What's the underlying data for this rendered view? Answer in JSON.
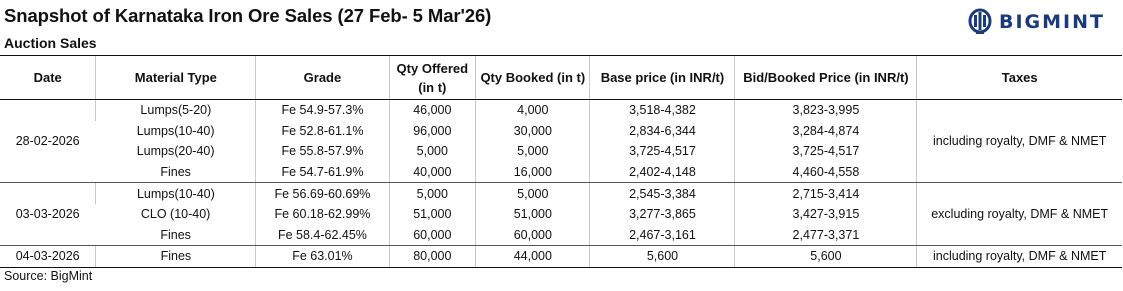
{
  "title": "Snapshot of Karnataka Iron Ore Sales (27 Feb- 5 Mar'26)",
  "subtitle": "Auction Sales",
  "logo": {
    "text": "BIGMINT",
    "color": "#1a3a7a"
  },
  "table": {
    "headers": [
      "Date",
      "Material Type",
      "Grade",
      "Qty Offered (in t)",
      "Qty Booked (in t)",
      "Base price (in INR/t)",
      "Bid/Booked Price (in INR/t)",
      "Taxes"
    ],
    "groups": [
      {
        "date": "28-02-2026",
        "taxes": "including royalty, DMF & NMET",
        "rows": [
          {
            "material": "Lumps(5-20)",
            "grade": "Fe 54.9-57.3%",
            "qty_offered": "46,000",
            "qty_booked": "4,000",
            "base_price": "3,518-4,382",
            "bid_price": "3,823-3,995"
          },
          {
            "material": "Lumps(10-40)",
            "grade": "Fe 52.8-61.1%",
            "qty_offered": "96,000",
            "qty_booked": "30,000",
            "base_price": "2,834-6,344",
            "bid_price": "3,284-4,874"
          },
          {
            "material": "Lumps(20-40)",
            "grade": "Fe 55.8-57.9%",
            "qty_offered": "5,000",
            "qty_booked": "5,000",
            "base_price": "3,725-4,517",
            "bid_price": "3,725-4,517"
          },
          {
            "material": "Fines",
            "grade": "Fe 54.7-61.9%",
            "qty_offered": "40,000",
            "qty_booked": "16,000",
            "base_price": "2,402-4,148",
            "bid_price": "4,460-4,558"
          }
        ]
      },
      {
        "date": "03-03-2026",
        "taxes": "excluding royalty, DMF & NMET",
        "rows": [
          {
            "material": "Lumps(10-40)",
            "grade": "Fe 56.69-60.69%",
            "qty_offered": "5,000",
            "qty_booked": "5,000",
            "base_price": "2,545-3,384",
            "bid_price": "2,715-3,414"
          },
          {
            "material": "CLO (10-40)",
            "grade": "Fe 60.18-62.99%",
            "qty_offered": "51,000",
            "qty_booked": "51,000",
            "base_price": "3,277-3,865",
            "bid_price": "3,427-3,915"
          },
          {
            "material": "Fines",
            "grade": "Fe 58.4-62.45%",
            "qty_offered": "60,000",
            "qty_booked": "60,000",
            "base_price": "2,467-3,161",
            "bid_price": "2,477-3,371"
          }
        ]
      },
      {
        "date": "04-03-2026",
        "taxes": "including royalty, DMF & NMET",
        "rows": [
          {
            "material": "Fines",
            "grade": "Fe 63.01%",
            "qty_offered": "80,000",
            "qty_booked": "44,000",
            "base_price": "5,600",
            "bid_price": "5,600"
          }
        ]
      }
    ]
  },
  "source": "Source: BigMint"
}
